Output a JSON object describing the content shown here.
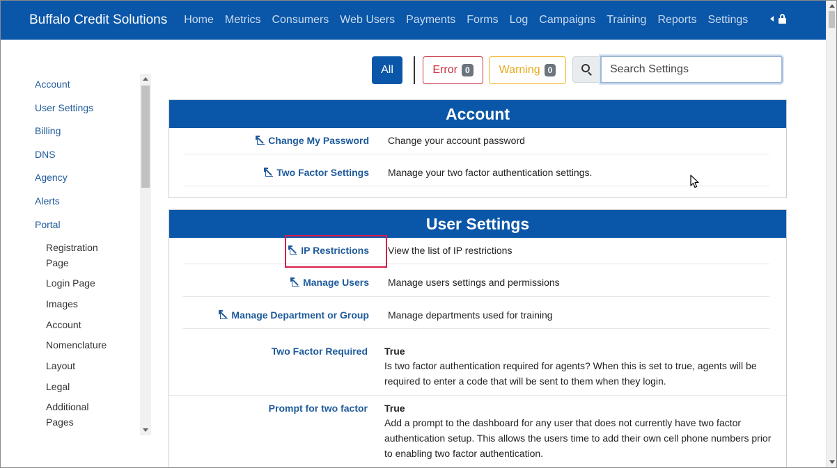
{
  "brand": "Buffalo Credit Solutions",
  "nav": [
    "Home",
    "Metrics",
    "Consumers",
    "Web Users",
    "Payments",
    "Forms",
    "Log",
    "Campaigns",
    "Training",
    "Reports",
    "Settings"
  ],
  "sidebar": {
    "items": [
      "Account",
      "User Settings",
      "Billing",
      "DNS",
      "Agency",
      "Alerts",
      "Portal"
    ],
    "subitems": [
      "Registration Page",
      "Login Page",
      "Images",
      "Account",
      "Nomenclature",
      "Layout",
      "Legal",
      "Additional Pages"
    ]
  },
  "filters": {
    "all": "All",
    "error_label": "Error",
    "error_count": "0",
    "warning_label": "Warning",
    "warning_count": "0",
    "search_placeholder": "Search Settings"
  },
  "sections": {
    "account": {
      "title": "Account",
      "rows": [
        {
          "link": "Change My Password",
          "desc": "Change your account password"
        },
        {
          "link": "Two Factor Settings",
          "desc": "Manage your two factor authentication settings."
        }
      ]
    },
    "user_settings": {
      "title": "User Settings",
      "rows": [
        {
          "link": "IP Restrictions",
          "desc": "View the list of IP restrictions"
        },
        {
          "link": "Manage Users",
          "desc": "Manage users settings and permissions"
        },
        {
          "link": "Manage Department or Group",
          "desc": "Manage departments used for training"
        }
      ],
      "settings": [
        {
          "name": "Two Factor Required",
          "value": "True",
          "desc": "Is two factor authentication required for agents? When this is set to true, agents will be required to enter a code that will be sent to them when they login."
        },
        {
          "name": "Prompt for two factor",
          "value": "True",
          "desc": "Add a prompt to the dashboard for any user that does not currently have two factor authentication setup. This allows the users time to add their own cell phone numbers prior to enabling two factor authentication."
        }
      ]
    }
  },
  "colors": {
    "primary": "#0a56a8",
    "link": "#1e5a9b",
    "error": "#c9303e",
    "warning": "#e6a817",
    "highlight": "#dc1a4a"
  },
  "icons": {
    "lock": "lock-icon",
    "search": "search-icon",
    "link": "external-link-icon"
  }
}
